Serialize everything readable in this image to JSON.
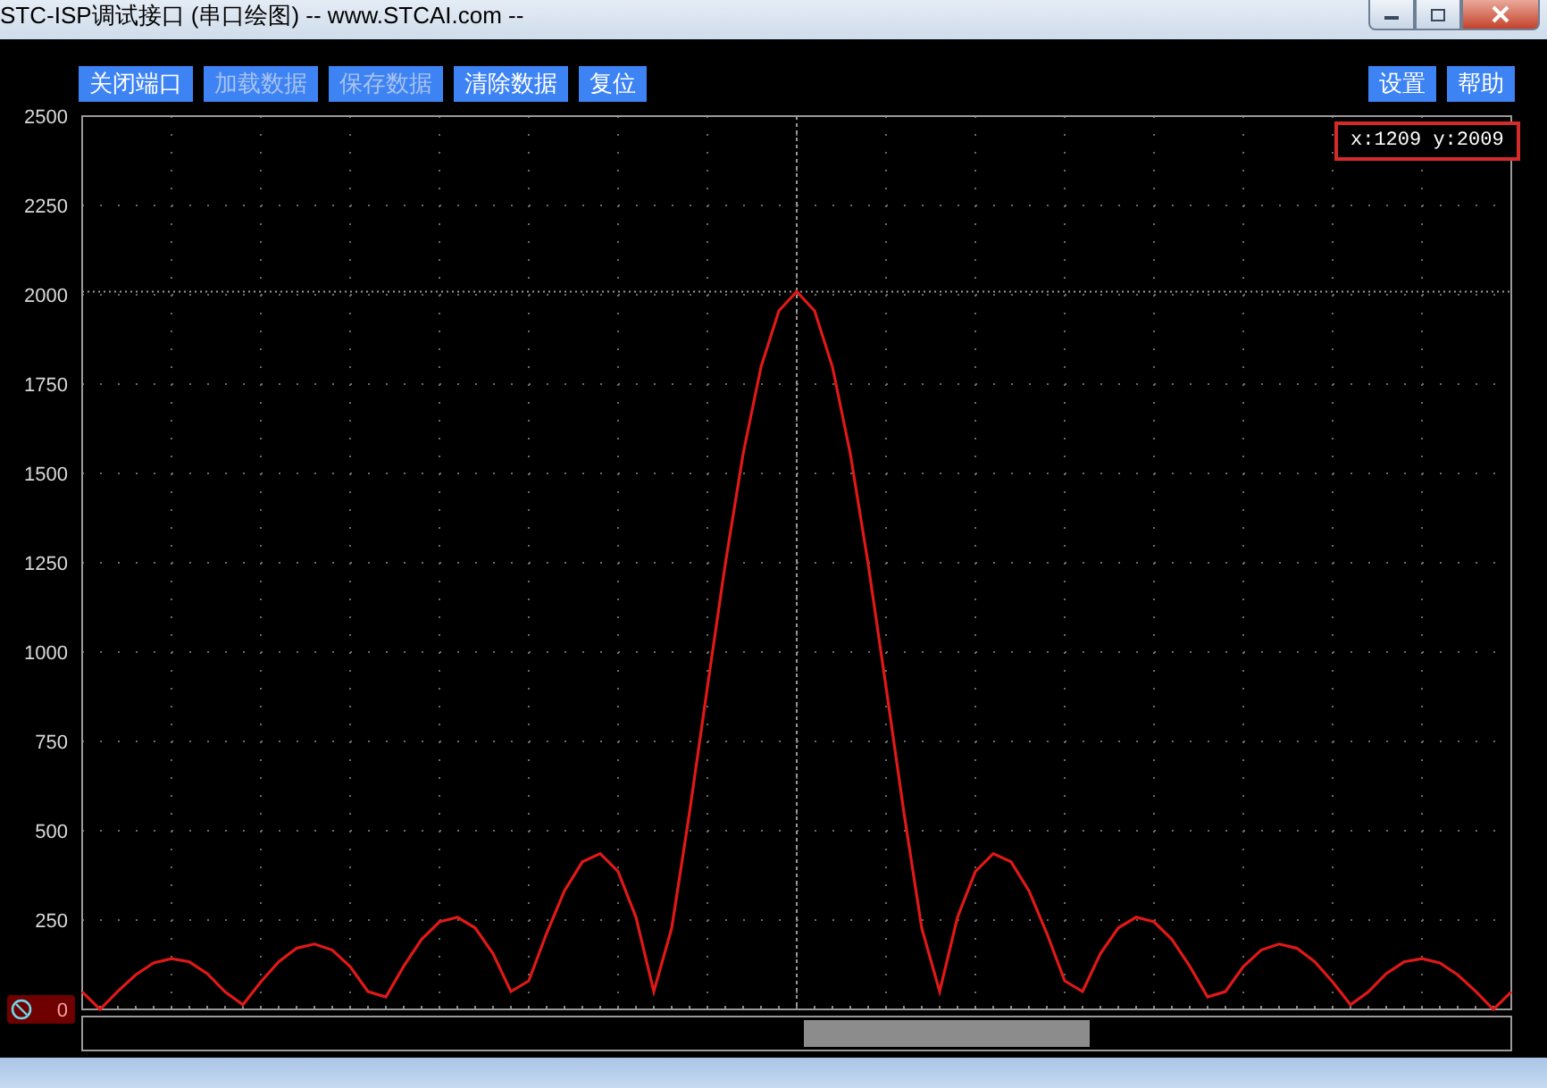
{
  "window": {
    "title": "STC-ISP调试接口 (串口绘图) -- www.STCAI.com --"
  },
  "toolbar": {
    "left": [
      {
        "label": "关闭端口",
        "disabled": false
      },
      {
        "label": "加载数据",
        "disabled": true
      },
      {
        "label": "保存数据",
        "disabled": true
      },
      {
        "label": "清除数据",
        "disabled": false
      },
      {
        "label": "复位",
        "disabled": false
      }
    ],
    "right": [
      {
        "label": "设置",
        "disabled": false
      },
      {
        "label": "帮助",
        "disabled": false
      }
    ]
  },
  "plot": {
    "cursor_readout": "x:1209 y:2009",
    "chart_data": {
      "type": "line",
      "grid": true,
      "ylim": [
        0,
        2500
      ],
      "yticks": [
        0,
        250,
        500,
        750,
        1000,
        1250,
        1500,
        1750,
        2000,
        2250,
        2500
      ],
      "series": [
        {
          "color": "#e01818",
          "values": [
            49,
            0,
            51,
            97,
            130,
            142,
            133,
            100,
            49,
            13,
            77,
            133,
            171,
            183,
            166,
            120,
            50,
            35,
            121,
            196,
            245,
            258,
            228,
            156,
            50,
            80,
            213,
            332,
            413,
            436,
            386,
            258,
            50,
            227,
            551,
            902,
            1246,
            1555,
            1798,
            1955,
            2009,
            1955,
            1798,
            1555,
            1246,
            902,
            551,
            227,
            50,
            258,
            386,
            436,
            413,
            332,
            213,
            80,
            50,
            156,
            228,
            258,
            245,
            196,
            121,
            35,
            50,
            120,
            166,
            183,
            171,
            133,
            77,
            13,
            49,
            100,
            133,
            142,
            130,
            97,
            51,
            0,
            49
          ]
        }
      ]
    }
  }
}
